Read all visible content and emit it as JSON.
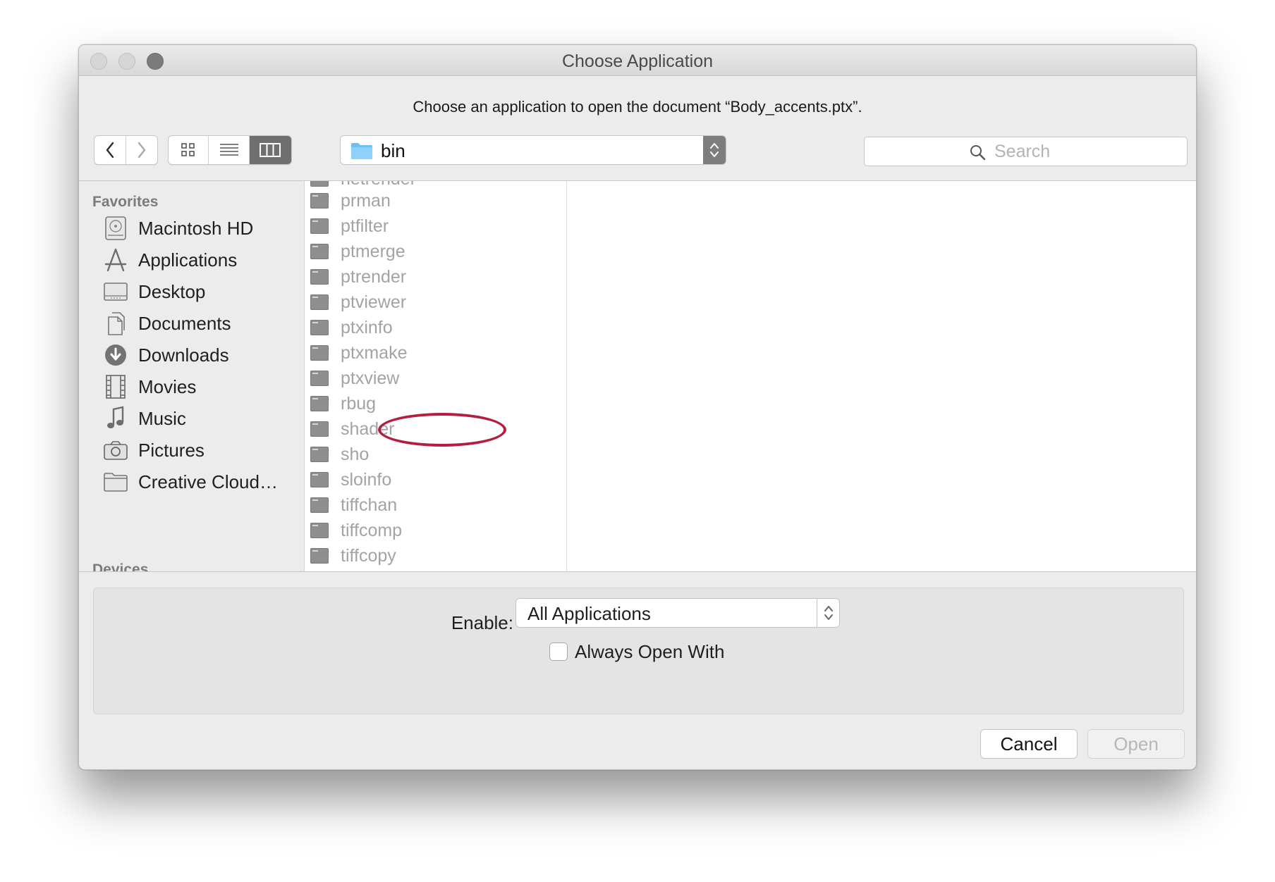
{
  "window": {
    "title": "Choose Application"
  },
  "instruction": "Choose an application to open the document “Body_accents.ptx”.",
  "toolbar": {
    "back_icon": "chevron-left-icon",
    "forward_icon": "chevron-right-icon",
    "view_modes": [
      "icon-view",
      "list-view",
      "column-view"
    ],
    "active_view": "column-view",
    "path": "bin",
    "search_placeholder": "Search"
  },
  "sidebar": {
    "favorites_heading": "Favorites",
    "devices_heading": "Devices",
    "items": [
      {
        "label": "Macintosh HD",
        "icon": "hard-drive-icon"
      },
      {
        "label": "Applications",
        "icon": "applications-icon"
      },
      {
        "label": "Desktop",
        "icon": "desktop-icon"
      },
      {
        "label": "Documents",
        "icon": "documents-icon"
      },
      {
        "label": "Downloads",
        "icon": "downloads-icon"
      },
      {
        "label": "Movies",
        "icon": "movies-icon"
      },
      {
        "label": "Music",
        "icon": "music-icon"
      },
      {
        "label": "Pictures",
        "icon": "pictures-icon"
      },
      {
        "label": "Creative Cloud…",
        "icon": "folder-icon"
      }
    ]
  },
  "files": [
    "netrender",
    "prman",
    "ptfilter",
    "ptmerge",
    "ptrender",
    "ptviewer",
    "ptxinfo",
    "ptxmake",
    "ptxview",
    "rbug",
    "shader",
    "sho",
    "sloinfo",
    "tiffchan",
    "tiffcomp",
    "tiffcopy"
  ],
  "annotation": {
    "highlighted_file": "ptxview",
    "color": "#b51d3d"
  },
  "options": {
    "enable_label": "Enable:",
    "enable_value": "All Applications",
    "always_open_label": "Always Open With",
    "always_open_checked": false
  },
  "buttons": {
    "cancel": "Cancel",
    "open": "Open"
  }
}
